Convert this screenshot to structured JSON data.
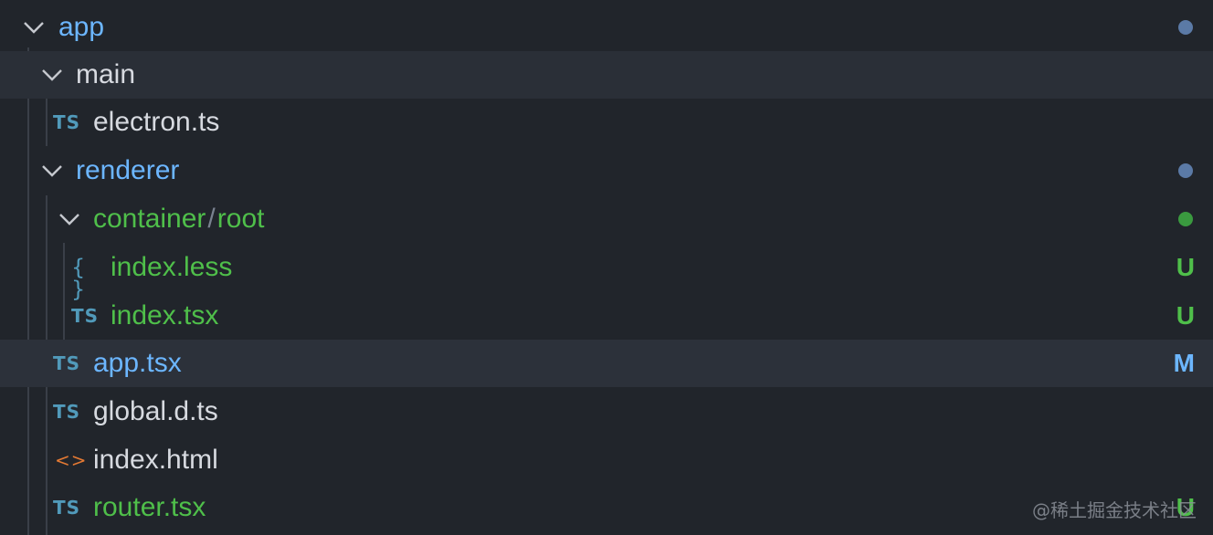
{
  "tree": {
    "app": {
      "label": "app",
      "status_dot_color": "#5b7aa6"
    },
    "main": {
      "label": "main"
    },
    "electron": {
      "icon": "TS",
      "label": "electron.ts"
    },
    "renderer": {
      "label": "renderer",
      "status_dot_color": "#5b7aa6"
    },
    "container_root": {
      "label_part1": "container",
      "separator": "/",
      "label_part2": "root",
      "status_dot_color": "#3a9a3f"
    },
    "index_less": {
      "icon": "{ }",
      "label": "index.less",
      "badge": "U"
    },
    "index_tsx": {
      "icon": "TS",
      "label": "index.tsx",
      "badge": "U"
    },
    "app_tsx": {
      "icon": "TS",
      "label": "app.tsx",
      "badge": "M"
    },
    "global_d_ts": {
      "icon": "TS",
      "label": "global.d.ts"
    },
    "index_html": {
      "icon": "<>",
      "label": "index.html"
    },
    "router_tsx": {
      "icon": "TS",
      "label": "router.tsx",
      "badge": "U"
    }
  },
  "colors": {
    "untracked": "#4fbf4a",
    "modified": "#6cb6ff",
    "folder_blue": "#6cb6ff",
    "ts_icon": "#519aba",
    "html_icon": "#e37933"
  },
  "watermark": "@稀土掘金技术社区"
}
